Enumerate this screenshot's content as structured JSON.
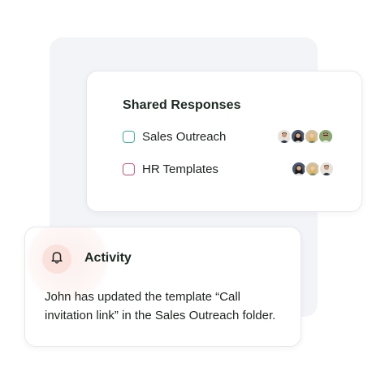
{
  "shared_responses": {
    "title": "Shared Responses",
    "folders": [
      {
        "label": "Sales Outreach",
        "checkbox_color": "#3fb597",
        "checked": false,
        "avatars": [
          "avatar-man-dark-hair",
          "avatar-woman-dark-hair",
          "avatar-woman-blonde",
          "avatar-man-glasses"
        ]
      },
      {
        "label": "HR Templates",
        "checkbox_color": "#d9537a",
        "checked": false,
        "avatars": [
          "avatar-woman-dark-hair",
          "avatar-woman-blonde",
          "avatar-man-dark-hair"
        ]
      }
    ]
  },
  "activity": {
    "title": "Activity",
    "icon": "bell-icon",
    "icon_background": "#fbe1dc",
    "message": "John has updated the template “Call invitation link” in the Sales Outreach folder."
  }
}
